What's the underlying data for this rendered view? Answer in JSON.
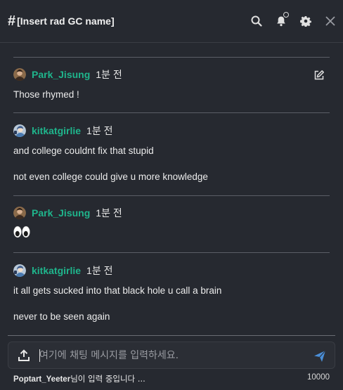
{
  "header": {
    "hash": "#",
    "title": "[Insert rad GC name]",
    "icons": [
      "search-icon",
      "bell-icon",
      "gear-icon",
      "close-icon"
    ]
  },
  "messages": [
    {
      "author": "Park_Jisung",
      "time": "1분 전",
      "avatar": "avatar-brown",
      "lines": [
        "Those rhymed !"
      ],
      "editable": true
    },
    {
      "author": "kitkatgirlie",
      "time": "1분 전",
      "avatar": "avatar-blue",
      "lines": [
        "and college couldnt fix that stupid",
        "not even college could give u more knowledge"
      ]
    },
    {
      "author": "Park_Jisung",
      "time": "1분 전",
      "avatar": "avatar-brown",
      "lines": [
        "👀"
      ]
    },
    {
      "author": "kitkatgirlie",
      "time": "1분 전",
      "avatar": "avatar-blue",
      "lines": [
        "it all gets sucked into that black hole u call a brain",
        "never to be seen again"
      ]
    }
  ],
  "composer": {
    "placeholder": "여기에 채팅 메시지를 입력하세요.",
    "value": ""
  },
  "status": {
    "typing_user": "Poptart_Yeeter",
    "typing_suffix": "님이 입력 중입니다 ...",
    "char_limit": "10000"
  },
  "colors": {
    "background": "#262930",
    "author": "#1fb58c",
    "send": "#4a8fd9"
  }
}
